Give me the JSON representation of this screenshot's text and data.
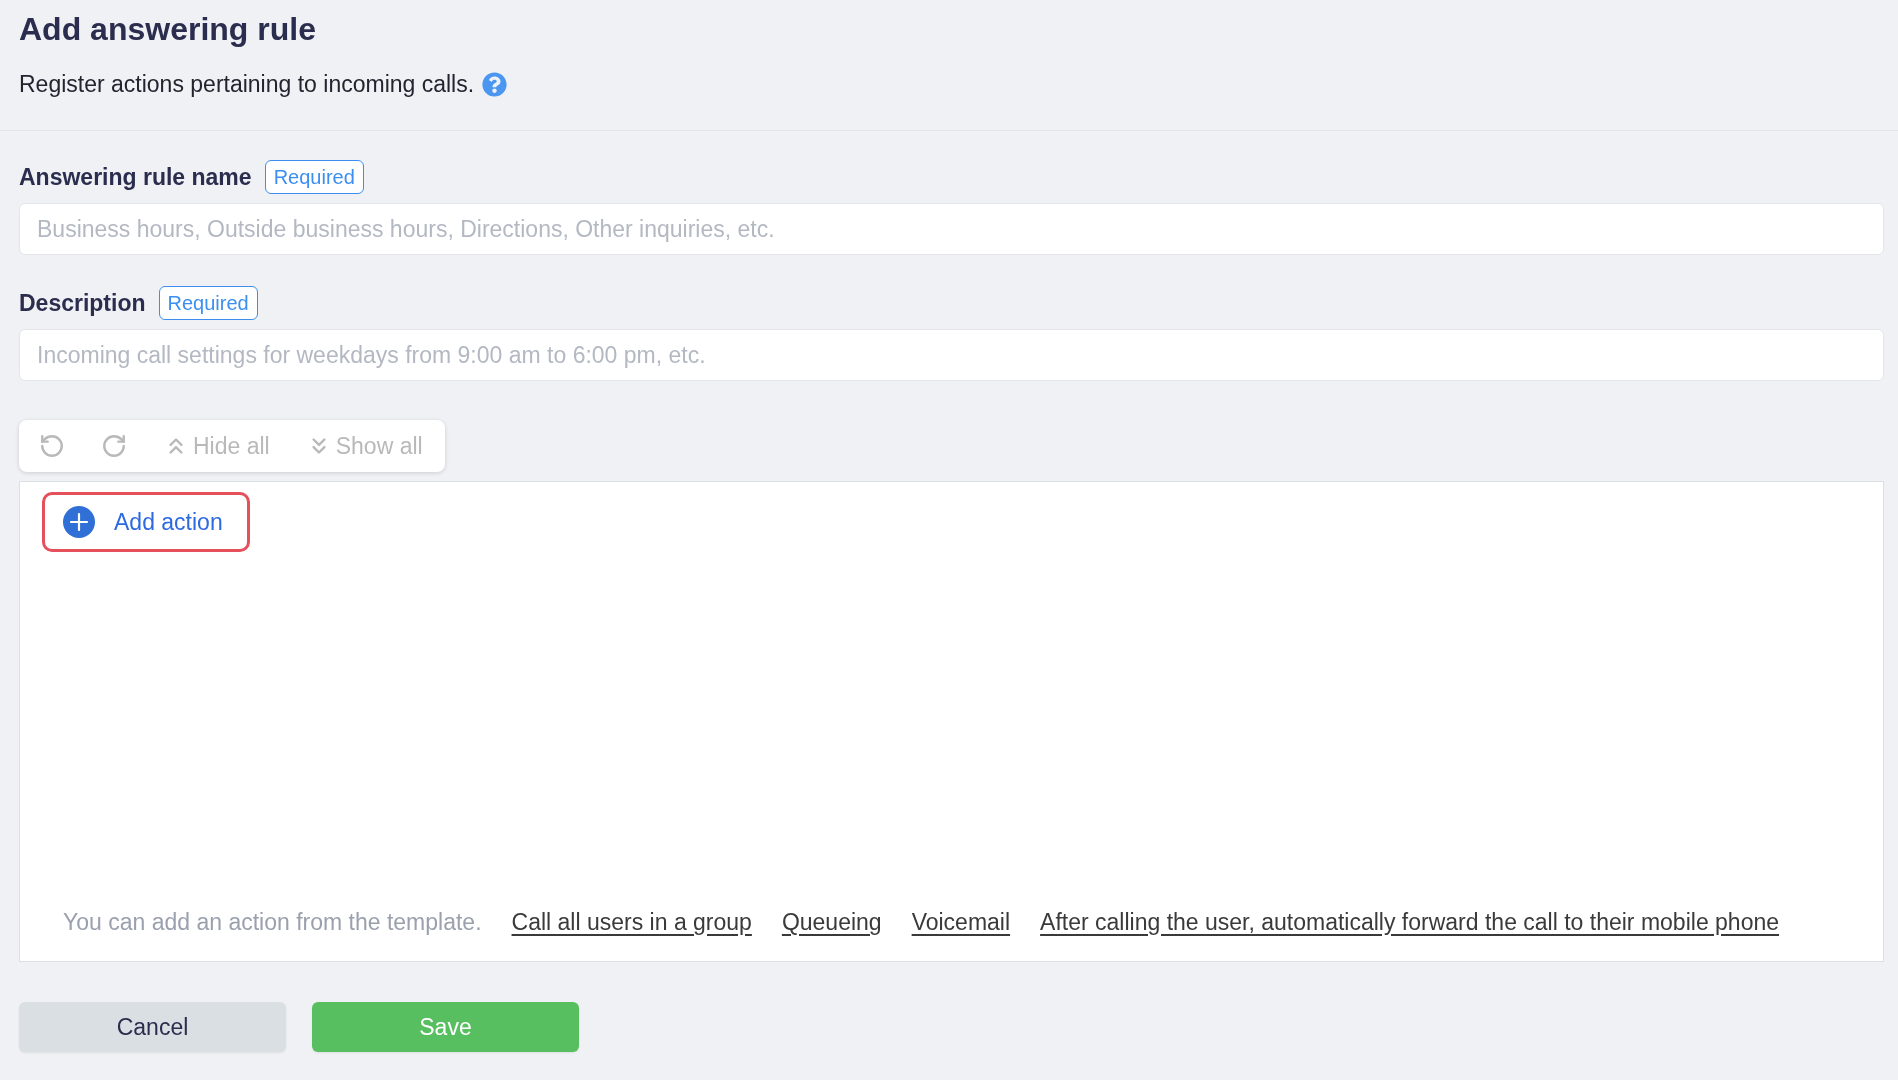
{
  "header": {
    "title": "Add answering rule",
    "subtitle": "Register actions pertaining to incoming calls."
  },
  "fields": [
    {
      "label": "Answering rule name",
      "badge": "Required",
      "placeholder": "Business hours, Outside business hours, Directions, Other inquiries, etc."
    },
    {
      "label": "Description",
      "badge": "Required",
      "placeholder": "Incoming call settings for weekdays from 9:00 am to 6:00 pm, etc."
    }
  ],
  "toolbar": [
    {
      "kind": "undo",
      "disabled": true
    },
    {
      "kind": "redo",
      "disabled": true
    },
    {
      "kind": "collapse",
      "label": "Hide all",
      "disabled": true
    },
    {
      "kind": "expand",
      "label": "Show all",
      "disabled": true
    }
  ],
  "actions_panel": {
    "add_action": {
      "label": "Add action",
      "highlighted": true
    },
    "template_hint": "You can add an action from the template.",
    "templates": [
      "Call all users in a group",
      "Queueing",
      "Voicemail",
      "After calling the user, automatically forward the call to their mobile phone"
    ]
  },
  "buttons": [
    {
      "kind": "cancel",
      "label": "Cancel"
    },
    {
      "kind": "save",
      "label": "Save"
    }
  ]
}
